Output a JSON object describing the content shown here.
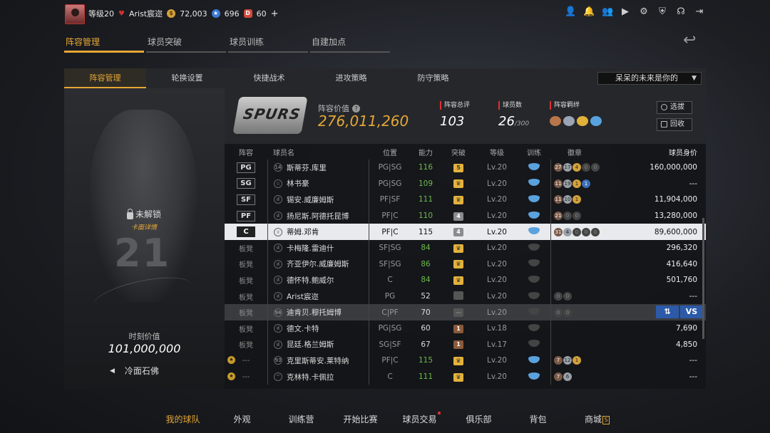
{
  "top": {
    "level": "等级20",
    "username": "Arist宸迩",
    "gold": "72,003",
    "stars": "696",
    "tickets": "60",
    "plus": "+"
  },
  "main_tabs": [
    "阵容管理",
    "球员突破",
    "球员训练",
    "自建加点"
  ],
  "sub_tabs": [
    "阵容管理",
    "轮换设置",
    "快捷战术",
    "进攻策略",
    "防守策略"
  ],
  "dropdown": "呆呆的未来是你的",
  "card": {
    "jersey": "21",
    "locked": "未解锁",
    "detail": "卡面详情",
    "moment_label": "时刻价值",
    "moment_value": "101,000,000",
    "name": "冷面石佛"
  },
  "team": {
    "logo_text": "SPURS",
    "value_label": "阵容价值",
    "value": "276,011,260",
    "ovr_label": "阵容总评",
    "ovr": "103",
    "count_label": "球员数",
    "count": "26",
    "count_max": "/300",
    "bond_label": "阵容羁绊",
    "btn_select": "选拔",
    "btn_recycle": "回收"
  },
  "table": {
    "headers": [
      "阵容",
      "球员名",
      "位置",
      "能力",
      "突破",
      "等级",
      "训练",
      "徽章",
      "球员身价"
    ],
    "rows": [
      {
        "pos": "PG",
        "num": "14",
        "name": "斯蒂芬.库里",
        "role": "PG|SG",
        "ovr": "116",
        "brk": "5",
        "lvl": "Lv.20",
        "badges": [
          "27",
          "17",
          "4",
          "0",
          "0"
        ],
        "worth": "160,000,000"
      },
      {
        "pos": "SG",
        "num": "☆",
        "name": "林书豪",
        "role": "PG|SG",
        "ovr": "109",
        "brk": "♛",
        "lvl": "Lv.20",
        "badges": [
          "11",
          "19",
          "1",
          "1"
        ],
        "worth": "---"
      },
      {
        "pos": "SF",
        "num": "ıl",
        "name": "锡安.威廉姆斯",
        "role": "PF|SF",
        "ovr": "111",
        "brk": "♛",
        "lvl": "Lv.20",
        "badges": [
          "11",
          "10",
          "1"
        ],
        "worth": "11,904,000"
      },
      {
        "pos": "PF",
        "num": "ıl",
        "name": "扬尼斯.阿德托昆博",
        "role": "PF|C",
        "ovr": "110",
        "brk": "4",
        "lvl": "Lv.20",
        "badges": [
          "21",
          "0",
          "0"
        ],
        "worth": "13,280,000"
      },
      {
        "pos": "C",
        "num": "♛",
        "name": "蒂姆.邓肯",
        "role": "PF|C",
        "ovr": "115",
        "brk": "4",
        "lvl": "Lv.20",
        "badges": [
          "31",
          "4",
          "0",
          "0",
          "0"
        ],
        "worth": "89,600,000"
      },
      {
        "pos": "板凳",
        "num": "ıl",
        "name": "卡梅隆.雷迪什",
        "role": "SF|SG",
        "ovr": "84",
        "brk": "♛",
        "lvl": "Lv.20",
        "badges": [],
        "worth": "296,320"
      },
      {
        "pos": "板凳",
        "num": "ıl",
        "name": "齐亚伊尔.威廉姆斯",
        "role": "SF|SG",
        "ovr": "86",
        "brk": "♛",
        "lvl": "Lv.20",
        "badges": [],
        "worth": "416,640"
      },
      {
        "pos": "板凳",
        "num": "ıl",
        "name": "德怀特.鲍威尔",
        "role": "C",
        "ovr": "84",
        "brk": "♛",
        "lvl": "Lv.20",
        "badges": [],
        "worth": "501,760"
      },
      {
        "pos": "板凳",
        "num": "ıl",
        "name": "Arist宸迩",
        "role": "PG",
        "ovr": "52",
        "brk": "",
        "lvl": "Lv.20",
        "badges": [
          "0",
          "0"
        ],
        "worth": "---"
      },
      {
        "pos": "板凳",
        "num": "94",
        "name": "迪肯贝.穆托姆博",
        "role": "C|PF",
        "ovr": "70",
        "brk": "—",
        "lvl": "Lv.20",
        "badges": [
          "0",
          "0"
        ],
        "worth": ""
      },
      {
        "pos": "板凳",
        "num": "ıl",
        "name": "德文.卡特",
        "role": "PG|SG",
        "ovr": "60",
        "brk": "1",
        "lvl": "Lv.18",
        "badges": [],
        "worth": "7,690"
      },
      {
        "pos": "板凳",
        "num": "ıl",
        "name": "昆廷.格兰姆斯",
        "role": "SG|SF",
        "ovr": "67",
        "brk": "1",
        "lvl": "Lv.17",
        "badges": [],
        "worth": "4,850"
      },
      {
        "pos": "---",
        "num": "93",
        "name": "克里斯蒂安.莱特纳",
        "role": "PF|C",
        "ovr": "115",
        "brk": "♛",
        "lvl": "Lv.20",
        "badges": [
          "7",
          "12",
          "1"
        ],
        "worth": "---"
      },
      {
        "pos": "---",
        "num": "⌔",
        "name": "克林特.卡佩拉",
        "role": "C",
        "ovr": "111",
        "brk": "♛",
        "lvl": "Lv.20",
        "badges": [
          "7",
          "6"
        ],
        "worth": "---"
      }
    ],
    "vs_swap": "⇅",
    "vs": "VS"
  },
  "bottom_nav": [
    "我的球队",
    "外观",
    "训练营",
    "开始比赛",
    "球员交易",
    "俱乐部",
    "背包",
    "商城"
  ],
  "colors": {
    "accent": "#e5a735",
    "ovr_green": "#6dbb4d",
    "vs_blue": "#2c5aa8"
  }
}
